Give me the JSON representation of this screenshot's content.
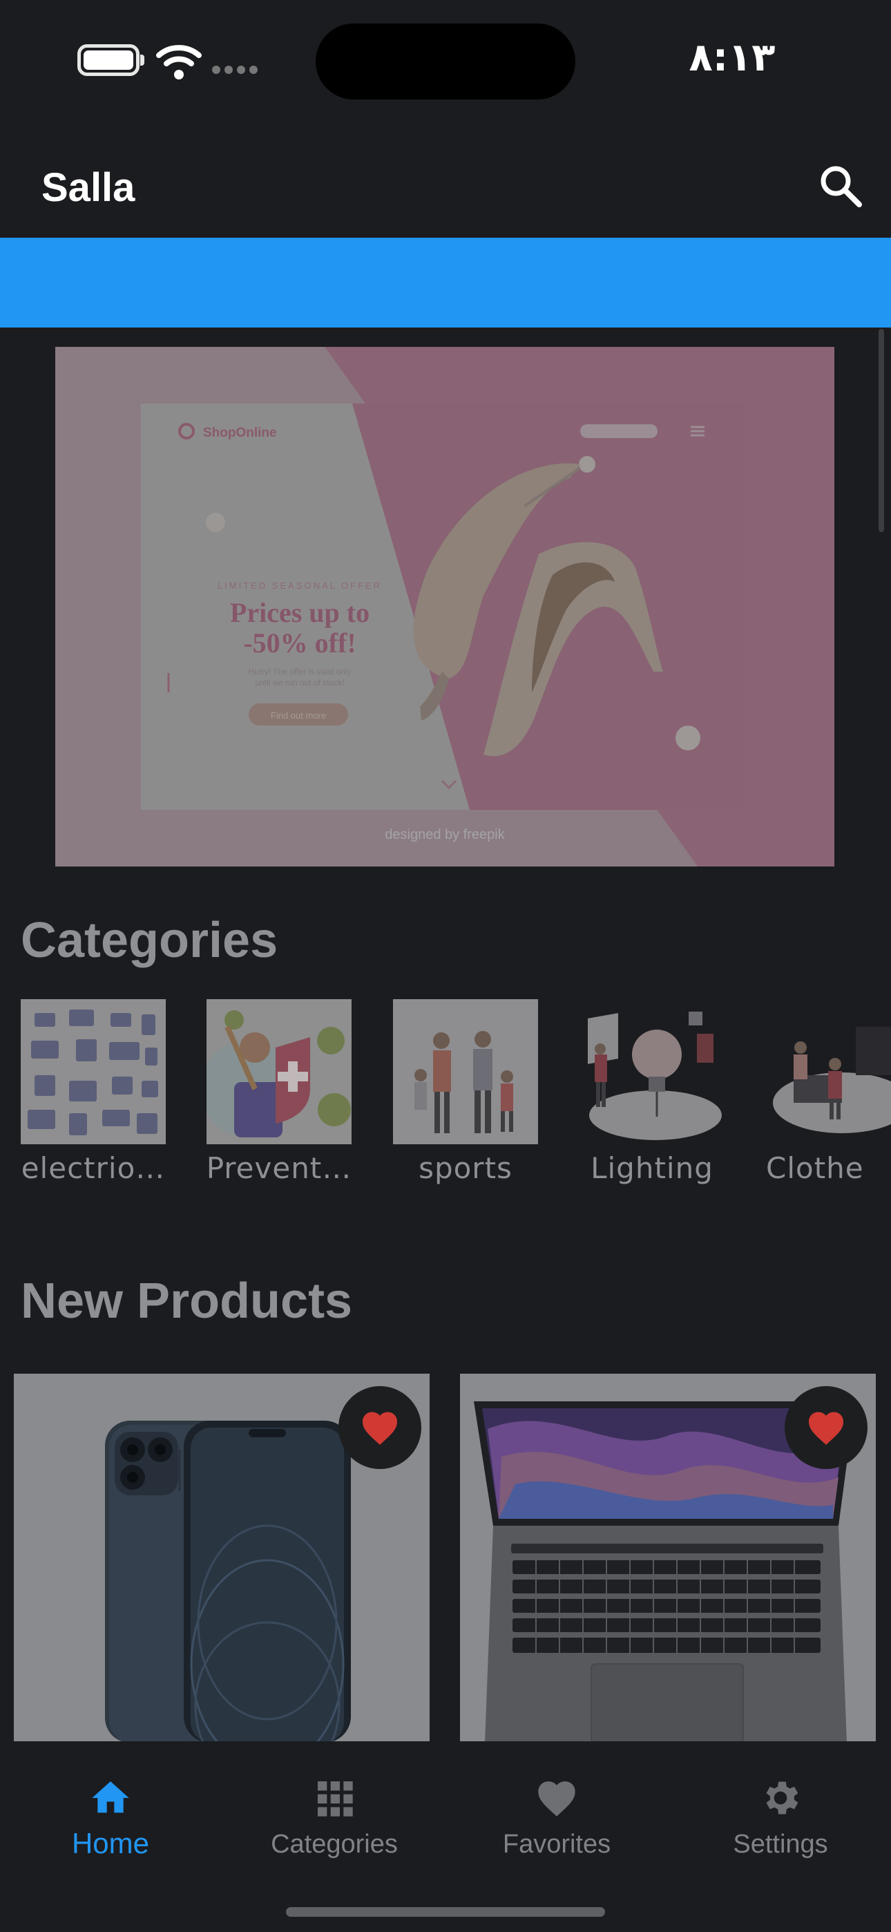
{
  "status_bar": {
    "time": "٨:١٣",
    "icons": [
      "battery-icon",
      "wifi-icon",
      "signal-dots-icon"
    ]
  },
  "app_bar": {
    "title": "Salla",
    "search_icon": "search-icon"
  },
  "banner": {
    "brand": "ShopOnline",
    "offer_label": "LIMITED SEASONAL OFFER",
    "headline_line1": "Prices up to",
    "headline_line2": "-50% off!",
    "subtext_line1": "Hurry! The offer is valid only",
    "subtext_line2": "until we run out of stock!",
    "cta": "Find out more",
    "credit": "designed by  freepik"
  },
  "categories": {
    "title": "Categories",
    "items": [
      {
        "label": "electrio…"
      },
      {
        "label": "Prevent…"
      },
      {
        "label": "sports"
      },
      {
        "label": "Lighting"
      },
      {
        "label": "Clothe"
      }
    ]
  },
  "new_products": {
    "title": "New Products",
    "items": [
      {
        "product": "iphone",
        "favorite_icon": "heart-icon",
        "favorite_color": "#d03a33"
      },
      {
        "product": "macbook",
        "favorite_icon": "heart-icon",
        "favorite_color": "#d03a33"
      }
    ]
  },
  "bottom_nav": {
    "items": [
      {
        "label": "Home",
        "icon": "home-icon",
        "active": true
      },
      {
        "label": "Categories",
        "icon": "grid-icon",
        "active": false
      },
      {
        "label": "Favorites",
        "icon": "heart-icon",
        "active": false
      },
      {
        "label": "Settings",
        "icon": "gear-icon",
        "active": false
      }
    ]
  },
  "colors": {
    "accent": "#2196f3",
    "background": "#1b1c1f",
    "heart": "#d03a33"
  }
}
